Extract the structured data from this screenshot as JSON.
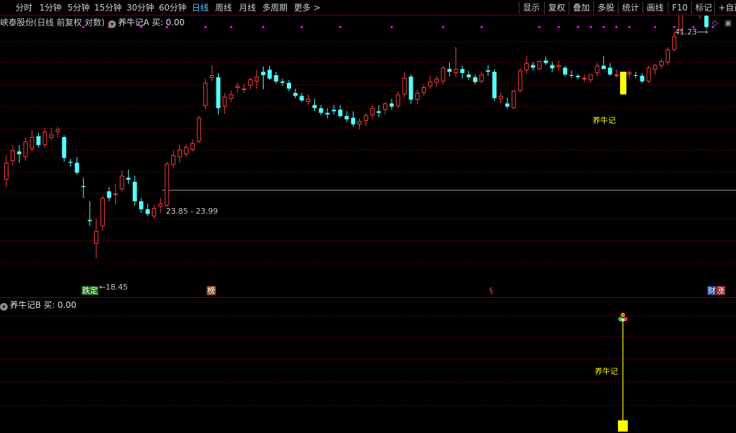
{
  "toolbar": {
    "periods": [
      "分时",
      "1分钟",
      "5分钟",
      "15分钟",
      "30分钟",
      "60分钟",
      "日线",
      "周线",
      "月线",
      "多周期",
      "更多"
    ],
    "active_period": "日线",
    "more_arrow": ">",
    "tools": [
      "显示",
      "复权",
      "叠加",
      "多股",
      "统计",
      "画线",
      "F10",
      "标记",
      "+自选"
    ]
  },
  "main_panel": {
    "stock_title": "峡泰股份(日线 前复权 对数)",
    "indicator_title": "养牛记A 买: 0.00",
    "max_label": "41.23",
    "min_label": "18.45",
    "range_label": "23.85 - 23.99",
    "signal_text": "养牛记",
    "bottom_tags": [
      {
        "text": "跌定",
        "bg": "#1c6b1c",
        "fg": "#ffffff"
      },
      {
        "text": "榜",
        "bg": "#8a4a1a",
        "fg": "#ffffff"
      },
      {
        "text": "§",
        "bg": "",
        "fg": "#ff3030"
      },
      {
        "text": "财",
        "bg": "#1c3f8a",
        "fg": "#ffffff"
      },
      {
        "text": "涨",
        "bg": "#8a1c1c",
        "fg": "#ffffff"
      }
    ]
  },
  "sub_panel": {
    "indicator_title": "养牛记B 买: 0.00",
    "signal_text": "养牛记"
  },
  "colors": {
    "up": "#ff3c3c",
    "down": "#54ffff",
    "signal": "#ffff00",
    "dots": "#ff00ff",
    "price_line": "#9a9a9a"
  },
  "chart_data": {
    "type": "candlestick",
    "log_scale": true,
    "price_range": [
      18.45,
      41.23
    ],
    "ylim": [
      16.6,
      45.0
    ],
    "candles": [
      [
        25.0,
        27.5,
        24.3,
        26.7
      ],
      [
        26.9,
        28.6,
        26.4,
        28.0
      ],
      [
        27.9,
        28.6,
        26.7,
        27.6
      ],
      [
        27.3,
        29.5,
        26.9,
        29.0
      ],
      [
        28.2,
        30.3,
        27.9,
        29.5
      ],
      [
        29.6,
        30.0,
        28.3,
        28.6
      ],
      [
        28.6,
        30.6,
        28.3,
        30.1
      ],
      [
        29.4,
        30.6,
        29.2,
        29.8
      ],
      [
        30.1,
        30.7,
        29.4,
        30.4
      ],
      [
        29.5,
        29.7,
        26.8,
        27.2
      ],
      [
        26.8,
        27.1,
        26.3,
        26.7
      ],
      [
        26.7,
        27.3,
        25.5,
        25.7
      ],
      [
        24.4,
        25.2,
        23.3,
        24.3
      ],
      [
        21.4,
        23.0,
        20.9,
        21.3
      ],
      [
        19.5,
        21.5,
        18.45,
        20.5
      ],
      [
        20.9,
        23.5,
        20.5,
        23.3
      ],
      [
        23.9,
        24.3,
        23.0,
        23.3
      ],
      [
        23.6,
        24.6,
        22.7,
        23.7
      ],
      [
        24.1,
        25.9,
        23.9,
        25.4
      ],
      [
        25.2,
        26.0,
        24.6,
        25.0
      ],
      [
        24.8,
        25.4,
        22.6,
        23.0
      ],
      [
        23.0,
        23.3,
        22.0,
        22.3
      ],
      [
        22.3,
        22.8,
        21.7,
        21.9
      ],
      [
        21.7,
        22.7,
        21.5,
        22.4
      ],
      [
        22.5,
        23.3,
        22.0,
        22.8
      ],
      [
        22.6,
        26.8,
        22.5,
        26.6
      ],
      [
        26.5,
        28.0,
        26.2,
        27.5
      ],
      [
        27.3,
        28.6,
        26.7,
        28.1
      ],
      [
        27.6,
        28.7,
        27.3,
        28.4
      ],
      [
        28.1,
        29.2,
        27.9,
        28.8
      ],
      [
        29.0,
        32.0,
        28.8,
        31.8
      ],
      [
        33.3,
        37.0,
        32.8,
        36.4
      ],
      [
        37.1,
        39.0,
        36.6,
        37.5
      ],
      [
        37.2,
        37.8,
        32.2,
        33.0
      ],
      [
        33.2,
        35.0,
        32.3,
        34.5
      ],
      [
        34.2,
        35.3,
        33.8,
        34.8
      ],
      [
        35.7,
        36.5,
        35.0,
        36.0
      ],
      [
        35.4,
        36.3,
        35.0,
        35.6
      ],
      [
        36.0,
        37.2,
        35.5,
        36.9
      ],
      [
        36.6,
        38.3,
        35.6,
        37.3
      ],
      [
        38.0,
        38.8,
        35.5,
        37.5
      ],
      [
        38.3,
        38.9,
        36.8,
        37.0
      ],
      [
        37.5,
        38.0,
        36.3,
        36.6
      ],
      [
        36.6,
        37.0,
        36.0,
        36.4
      ],
      [
        36.4,
        36.8,
        35.2,
        35.6
      ],
      [
        35.0,
        35.6,
        34.3,
        34.6
      ],
      [
        34.6,
        35.0,
        33.8,
        34.0
      ],
      [
        33.8,
        34.8,
        33.4,
        34.2
      ],
      [
        33.4,
        34.2,
        32.6,
        33.0
      ],
      [
        33.0,
        33.4,
        32.1,
        32.4
      ],
      [
        32.4,
        33.0,
        31.7,
        32.2
      ],
      [
        32.8,
        33.4,
        32.2,
        32.6
      ],
      [
        32.8,
        33.4,
        31.8,
        32.0
      ],
      [
        32.0,
        32.6,
        31.3,
        31.6
      ],
      [
        31.8,
        32.6,
        30.7,
        31.0
      ],
      [
        31.0,
        31.7,
        30.4,
        31.4
      ],
      [
        31.4,
        32.4,
        30.8,
        32.1
      ],
      [
        32.1,
        33.4,
        31.7,
        33.0
      ],
      [
        32.6,
        33.4,
        31.9,
        32.4
      ],
      [
        32.8,
        33.8,
        32.2,
        33.6
      ],
      [
        33.6,
        34.2,
        32.8,
        33.2
      ],
      [
        33.3,
        35.2,
        33.0,
        34.8
      ],
      [
        34.8,
        37.9,
        34.4,
        37.1
      ],
      [
        37.3,
        37.6,
        33.6,
        34.1
      ],
      [
        34.1,
        35.4,
        33.5,
        35.0
      ],
      [
        35.0,
        36.2,
        34.6,
        35.8
      ],
      [
        35.9,
        37.4,
        35.6,
        36.6
      ],
      [
        36.4,
        37.4,
        35.8,
        37.0
      ],
      [
        36.6,
        38.9,
        36.2,
        38.6
      ],
      [
        38.4,
        39.4,
        37.3,
        38.0
      ],
      [
        37.8,
        41.8,
        37.3,
        38.4
      ],
      [
        38.4,
        38.9,
        37.0,
        37.8
      ],
      [
        37.6,
        38.1,
        36.8,
        37.2
      ],
      [
        37.2,
        37.6,
        36.2,
        36.5
      ],
      [
        36.6,
        38.0,
        36.3,
        37.6
      ],
      [
        38.2,
        39.0,
        37.4,
        38.0
      ],
      [
        38.0,
        38.4,
        34.0,
        34.3
      ],
      [
        34.2,
        35.1,
        33.6,
        34.6
      ],
      [
        33.6,
        34.4,
        32.9,
        33.2
      ],
      [
        33.0,
        35.4,
        32.9,
        35.3
      ],
      [
        35.3,
        38.5,
        35.0,
        38.2
      ],
      [
        38.2,
        40.4,
        37.7,
        39.3
      ],
      [
        39.0,
        39.5,
        38.2,
        38.6
      ],
      [
        38.4,
        39.7,
        38.2,
        39.6
      ],
      [
        39.7,
        40.3,
        39.0,
        39.3
      ],
      [
        39.0,
        39.5,
        38.0,
        38.5
      ],
      [
        38.7,
        39.7,
        38.1,
        39.0
      ],
      [
        38.6,
        38.9,
        37.3,
        37.6
      ],
      [
        37.5,
        38.2,
        37.1,
        37.4
      ],
      [
        37.4,
        37.7,
        36.9,
        37.2
      ],
      [
        37.0,
        37.6,
        36.6,
        37.1
      ],
      [
        36.8,
        37.2,
        36.4,
        37.6
      ],
      [
        37.8,
        39.3,
        37.3,
        38.9
      ],
      [
        38.9,
        40.4,
        38.5,
        38.4
      ],
      [
        38.6,
        39.3,
        37.4,
        37.6
      ],
      [
        37.6,
        38.3,
        37.1,
        37.6
      ],
      [
        37.3,
        38.0,
        36.9,
        37.5
      ],
      [
        37.6,
        38.2,
        37.0,
        37.9
      ],
      [
        37.5,
        38.0,
        37.1,
        37.4
      ],
      [
        37.4,
        37.8,
        36.4,
        36.6
      ],
      [
        36.6,
        38.9,
        36.4,
        38.6
      ],
      [
        38.3,
        39.2,
        37.5,
        39.0
      ],
      [
        38.9,
        40.0,
        38.4,
        39.6
      ],
      [
        39.4,
        41.8,
        39.0,
        41.4
      ],
      [
        41.4,
        44.3,
        41.1,
        43.6
      ],
      [
        44.6,
        48.0,
        44.1,
        47.8
      ],
      [
        48.8,
        52.5,
        48.3,
        50.0
      ],
      [
        48.6,
        49.9,
        47.4,
        48.0
      ],
      [
        47.8,
        49.4,
        46.6,
        48.9
      ],
      [
        47.2,
        48.0,
        44.8,
        45.2
      ],
      [
        47.6,
        56.2,
        47.2,
        55.8
      ]
    ]
  }
}
